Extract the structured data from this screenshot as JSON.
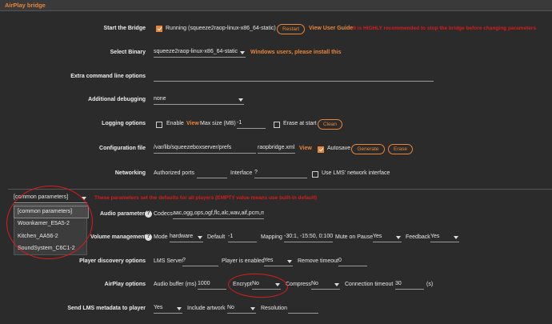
{
  "app": {
    "section_title": "AirPlay bridge"
  },
  "bridge": {
    "label": "Start the Bridge",
    "status": "Running (squeeze2raop-linux-x86_64-static)",
    "restart_button": "Restart",
    "user_guide_link": "View User Guide",
    "warning": "It is HIGHLY recommended to stop the bridge before changing parameters"
  },
  "binary": {
    "label": "Select Binary",
    "value": "squeeze2raop-linux-x86_64-static",
    "note": "Windows users, please install this"
  },
  "extra_cmd": {
    "label": "Extra command line options",
    "value": ""
  },
  "debugging": {
    "label": "Additional debugging",
    "value": "none"
  },
  "logging": {
    "label": "Logging options",
    "enable_label": "Enable",
    "view_link": "View",
    "max_size_label": "Max size (MB)",
    "max_size_value": "-1",
    "erase_label": "Erase at start",
    "clean_button": "Clean"
  },
  "config": {
    "label": "Configuration file",
    "path": "/var/lib/squeezeboxserver/prefs",
    "filename": "raopbridge.xml",
    "view_link": "View",
    "autosave_label": "Autosave",
    "generate_button": "Generate",
    "erase_button": "Erase"
  },
  "networking": {
    "label": "Networking",
    "ports_label": "Authorized ports",
    "ports_value": "",
    "interface_label": "Interface",
    "interface_value": "?",
    "lms_label": "Use LMS' network interface"
  },
  "player_select": {
    "value": "[common parameters]",
    "note": "These parameters set the defaults for all players (EMPTY value means use built-in default)",
    "options": [
      "[common parameters]",
      "Woonkamer_E5A5-2",
      "Kitchen_AA56-2",
      "SoundSystem_C6C1-2"
    ]
  },
  "audio": {
    "label": "Audio parameters",
    "codecs_label": "Codecs",
    "codecs_value": "aac,ogg,ops,ogf,flc,alc,wav,aif,pcm,m"
  },
  "volume": {
    "label": "Volume management",
    "mode_label": "Mode",
    "mode_value": "hardware",
    "default_label": "Default",
    "default_value": "-1",
    "mapping_label": "Mapping",
    "mapping_value": "-30:1, -15:50, 0:100",
    "mute_label": "Mute on Pause",
    "mute_value": "Yes",
    "feedback_label": "Feedback",
    "feedback_value": "Yes"
  },
  "discovery": {
    "label": "Player discovery options",
    "lms_server_label": "LMS Server",
    "lms_server_value": "?",
    "enabled_label": "Player is enabled",
    "enabled_value": "Yes",
    "timeout_label": "Remove timeout",
    "timeout_value": "0"
  },
  "airplay": {
    "label": "AirPlay options",
    "buffer_label": "Audio buffer (ms)",
    "buffer_value": "1000",
    "encrypt_label": "Encrypt",
    "encrypt_value": "No",
    "compress_label": "Compress",
    "compress_value": "No",
    "conn_timeout_label": "Connection timeout",
    "conn_timeout_value": "30",
    "conn_timeout_unit": "(s)"
  },
  "metadata": {
    "label": "Send LMS metadata to player",
    "value": "Yes",
    "artwork_label": "Include artwork",
    "artwork_value": "No",
    "resolution_label": "Resolution",
    "resolution_value": ""
  },
  "colors": {
    "accent": "#e8853a",
    "background": "#2b2b2b",
    "annotation": "#d81c1c"
  }
}
